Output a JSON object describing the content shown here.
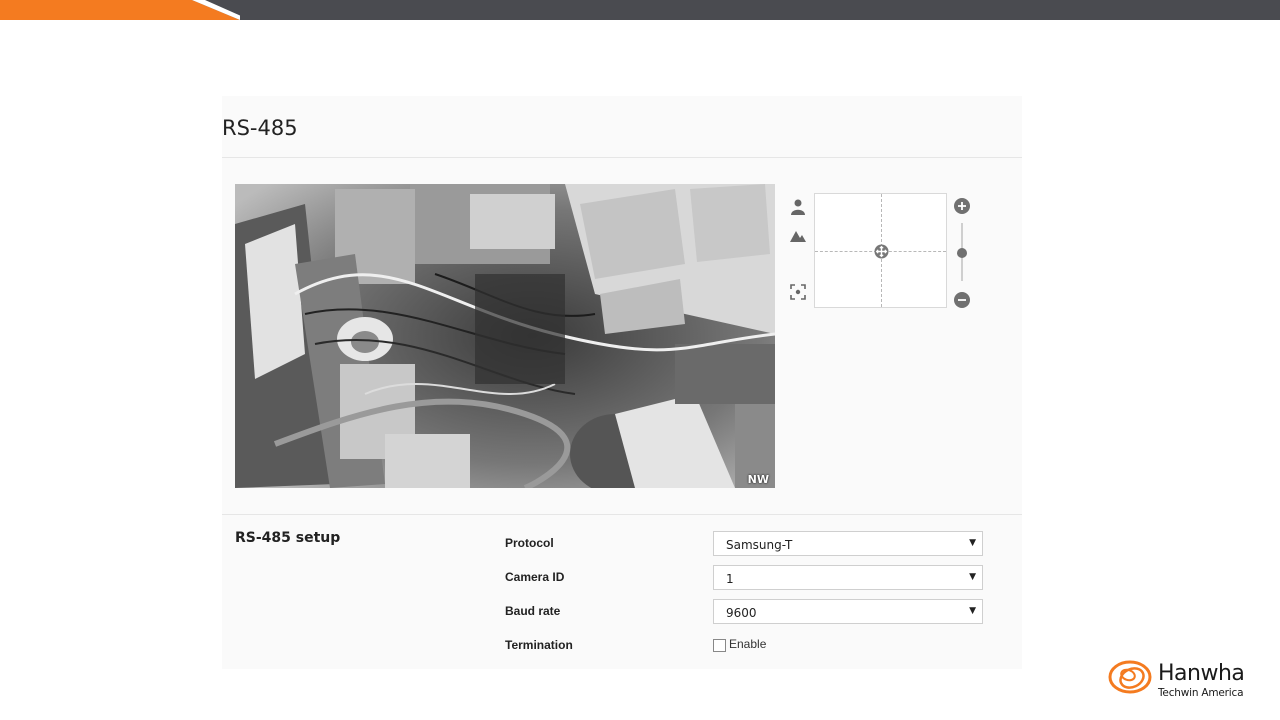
{
  "colors": {
    "accent": "#f47b20",
    "topbar": "#4a4b50",
    "panel": "#fafafa"
  },
  "panel": {
    "title": "RS-485",
    "video": {
      "direction_label": "NW"
    },
    "ptz": {
      "icons": [
        "person-icon",
        "mountain-icon",
        "focus-target-icon",
        "pan-tilt-center-icon",
        "zoom-in-icon",
        "zoom-out-icon"
      ]
    }
  },
  "setup": {
    "title": "RS-485 setup",
    "fields": {
      "protocol": {
        "label": "Protocol",
        "value": "Samsung-T"
      },
      "camera_id": {
        "label": "Camera ID",
        "value": "1"
      },
      "baud_rate": {
        "label": "Baud rate",
        "value": "9600"
      },
      "termination": {
        "label": "Termination",
        "option": "Enable",
        "checked": false
      }
    }
  },
  "brand": {
    "name": "Hanwha",
    "sub": "Techwin America"
  }
}
